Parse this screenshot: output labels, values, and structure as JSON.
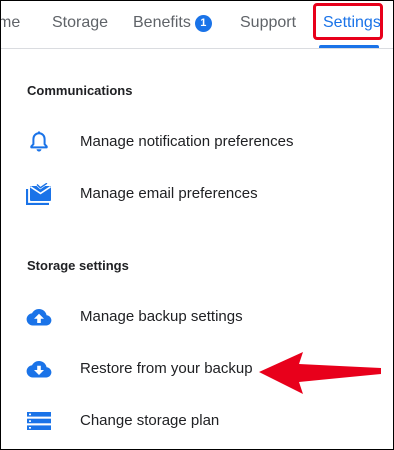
{
  "tabs": {
    "home": "me",
    "storage": "Storage",
    "benefits": "Benefits",
    "benefits_badge": "1",
    "support": "Support",
    "settings": "Settings"
  },
  "sections": {
    "communications": {
      "header": "Communications",
      "items": [
        {
          "label": "Manage notification preferences",
          "icon": "bell-icon"
        },
        {
          "label": "Manage email preferences",
          "icon": "mail-check-icon"
        }
      ]
    },
    "storage_settings": {
      "header": "Storage settings",
      "items": [
        {
          "label": "Manage backup settings",
          "icon": "cloud-upload-icon"
        },
        {
          "label": "Restore from your backup",
          "icon": "cloud-download-icon"
        },
        {
          "label": "Change storage plan",
          "icon": "storage-list-icon"
        }
      ]
    }
  },
  "colors": {
    "accent": "#1a73e8",
    "highlight": "#e8001b",
    "text": "#202124",
    "tab_text": "#5f6368"
  }
}
